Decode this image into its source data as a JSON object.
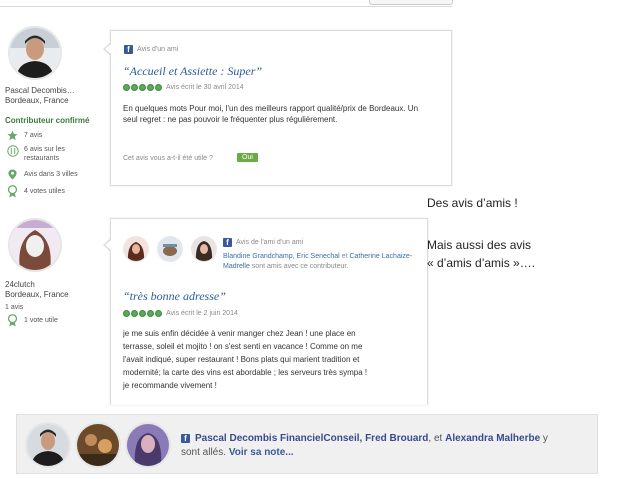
{
  "review1": {
    "user": {
      "name": "Pascal Decombis…",
      "location": "Bordeaux, France",
      "badge": "Contributeur confirmé",
      "stats": [
        {
          "icon": "star-icon",
          "text": "7 avis"
        },
        {
          "icon": "restaurant-icon",
          "text": "6 avis sur les restaurants"
        },
        {
          "icon": "map-pin-icon",
          "text": "Avis dans 3 villes"
        },
        {
          "icon": "helpful-vote-icon",
          "text": "4 votes utiles"
        }
      ]
    },
    "friend_label": "Avis d'un ami",
    "title": "“Accueil et Assiette : Super”",
    "rating": 5,
    "date": "Avis écrit le 30 avril 2014",
    "body": "En quelques mots Pour moi, l'un des meilleurs rapport qualité/prix de Bordeaux. Un seul regret : ne pas pouvoir le fréquenter plus régulièrement.",
    "helpful_question": "Cet avis vous a-t-il été utile ?",
    "helpful_button": "Oui"
  },
  "review2": {
    "user": {
      "name": "24clutch",
      "location": "Bordeaux, France",
      "stats": [
        {
          "icon": "count-icon",
          "text": "1 avis"
        },
        {
          "icon": "helpful-vote-icon",
          "text": "1 vote utile"
        }
      ]
    },
    "friend_label": "Avis de l'ami d'un ami",
    "friends_names": "Blandine Grandchamp, Eric Senechal",
    "friends_and": " et ",
    "friends_last": "Catherine Lachaize-Madrelle",
    "friends_suffix": " sont amis avec ce contributeur.",
    "title": "“très bonne adresse”",
    "rating": 5,
    "date": "Avis écrit le 2 juin 2014",
    "body_lines": [
      "je me suis enfin décidée à venir manger chez Jean ! une place en",
      "terrasse, soleil et mojito ! on s'est senti en vacance ! Comme on me",
      "l'avait indiqué, super restaurant ! Bons plats qui marient tradition et",
      "modernité; la carte des vins est abordable ; les serveurs très sympa !",
      "je recommande vivement !"
    ]
  },
  "side_note": {
    "line1": "Des avis d’amis !",
    "line2": "Mais aussi des avis",
    "line3": "« d’amis d’amis »…."
  },
  "bottom": {
    "names": "Pascal Decombis FinancielConseil, Fred Brouard",
    "and": ", et ",
    "last": "Alexandra Malherbe",
    "suffix": " y",
    "line2": "sont allés. ",
    "link": "Voir sa note..."
  },
  "colors": {
    "accent_green": "#5aa85a",
    "link_blue": "#2a5b9a",
    "facebook_blue": "#3b5998"
  }
}
